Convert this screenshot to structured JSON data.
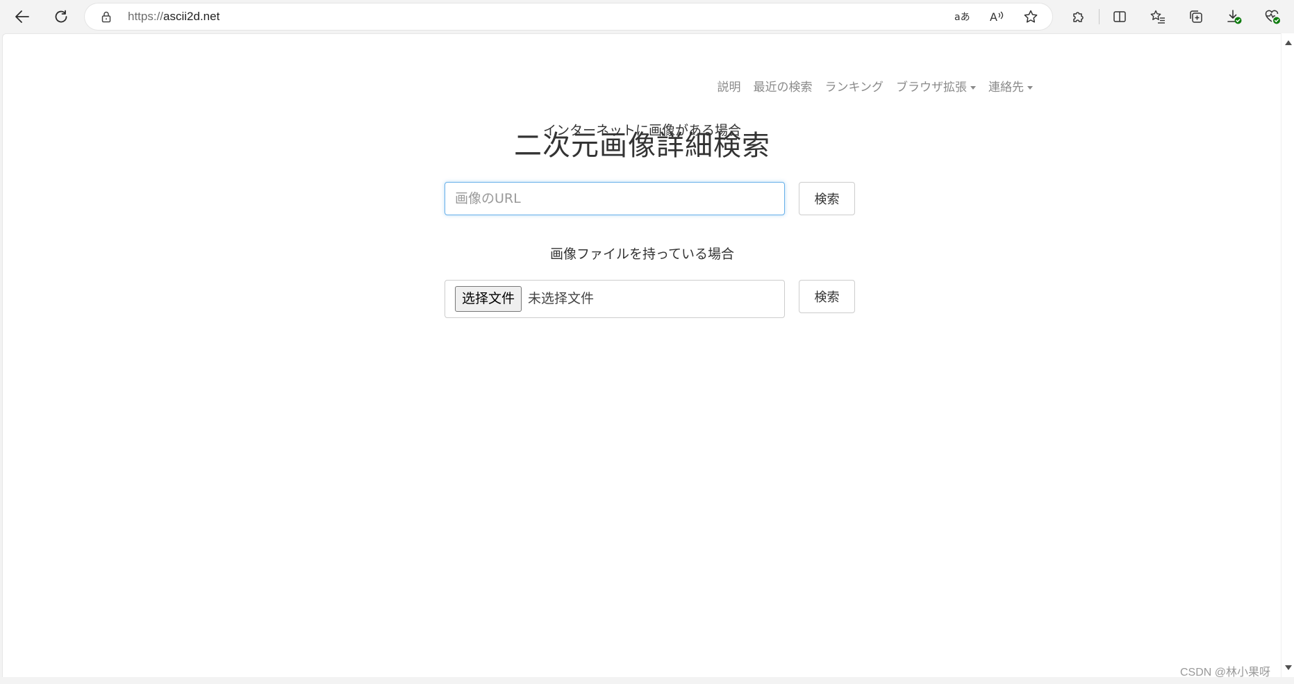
{
  "browser": {
    "url_scheme": "https://",
    "url_host": "ascii2d.net",
    "icons": {
      "back": "arrow-left-icon",
      "reload": "refresh-icon",
      "lock": "lock-icon",
      "translate": "translate-icon",
      "read_aloud": "read-aloud-icon",
      "favorite": "star-icon",
      "extensions": "puzzle-icon",
      "split_screen": "split-screen-icon",
      "favorites_list": "favorites-list-icon",
      "collections": "collections-icon",
      "downloads": "download-icon",
      "performance": "heartbeat-icon"
    }
  },
  "nav": {
    "items": [
      {
        "label": "説明",
        "dropdown": false
      },
      {
        "label": "最近の検索",
        "dropdown": false
      },
      {
        "label": "ランキング",
        "dropdown": false
      },
      {
        "label": "ブラウザ拡張",
        "dropdown": true
      },
      {
        "label": "連絡先",
        "dropdown": true
      }
    ]
  },
  "main": {
    "title": "二次元画像詳細検索",
    "url_section": {
      "label": "インターネットに画像がある場合",
      "input_placeholder": "画像のURL",
      "input_value": "",
      "button_label": "検索"
    },
    "file_section": {
      "label": "画像ファイルを持っている場合",
      "choose_button_label": "选择文件",
      "file_status": "未选择文件",
      "button_label": "検索"
    }
  },
  "watermark": "CSDN @林小果呀",
  "colors": {
    "focus_border": "#66afe9",
    "nav_text": "#8a8a8a",
    "title_text": "#333333"
  }
}
